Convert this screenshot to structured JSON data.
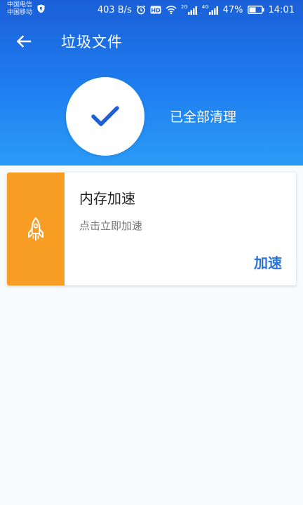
{
  "status_bar": {
    "carrier_1": "中国电信",
    "carrier_2": "中国移动",
    "speed": "403 B/s",
    "signal_1_label": "2G",
    "signal_2_label": "4G",
    "battery": "47%",
    "time": "14:01"
  },
  "toolbar": {
    "title": "垃圾文件"
  },
  "summary": {
    "status_text": "已全部清理"
  },
  "card": {
    "title": "内存加速",
    "subtitle": "点击立即加速",
    "action_label": "加速"
  },
  "colors": {
    "header_top": "#1a5fd8",
    "header_bottom": "#2a9bf6",
    "card_accent": "#f89e25",
    "action_text": "#2a73d9",
    "check_mark": "#1f5fd6"
  }
}
